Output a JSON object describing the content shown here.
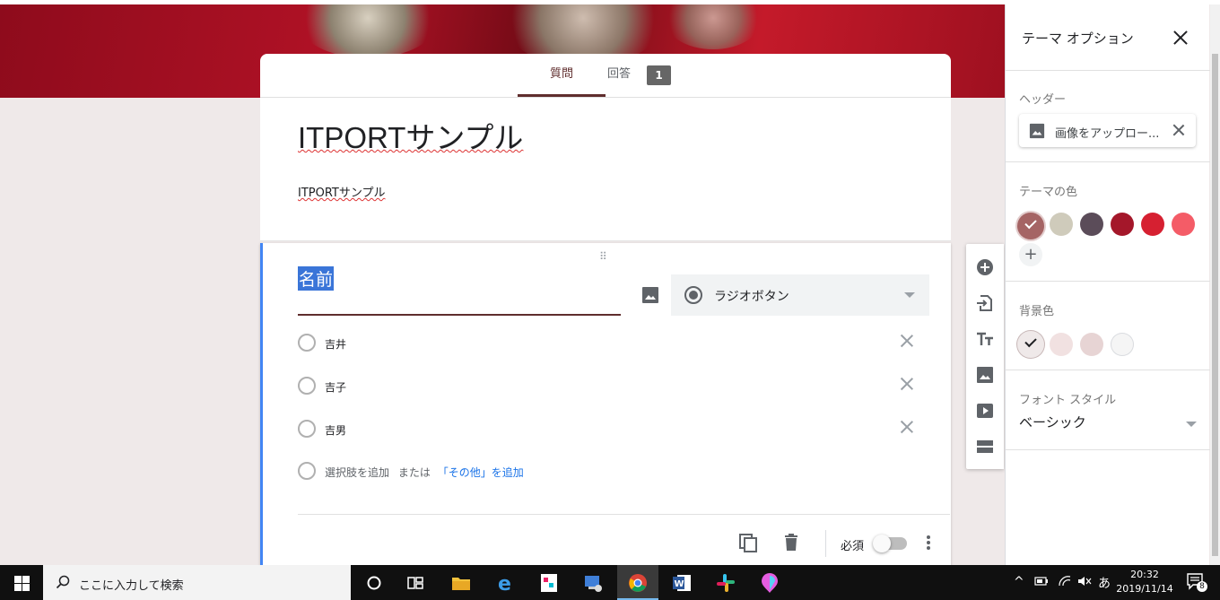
{
  "form": {
    "tabs": [
      {
        "label": "質問",
        "active": true
      },
      {
        "label": "回答",
        "active": false,
        "badge": "1"
      }
    ],
    "title": "ITPORTサンプル",
    "description": "ITPORTサンプル"
  },
  "question": {
    "title": "名前",
    "type_label": "ラジオボタン",
    "options": [
      "吉井",
      "吉子",
      "吉男"
    ],
    "add_option": "選択肢を追加",
    "or_text": "または",
    "add_other": "「その他」を追加",
    "required_label": "必須",
    "required": false
  },
  "panel": {
    "title": "テーマ オプション",
    "header_label": "ヘッダー",
    "upload_label": "画像をアップロー...",
    "theme_color_label": "テーマの色",
    "theme_colors": [
      "#a56464",
      "#cfcbbb",
      "#5b4c59",
      "#a4172a",
      "#d62031",
      "#f45c67"
    ],
    "selected_theme_color": "#a56464",
    "bg_color_label": "背景色",
    "bg_colors": [
      "#efe9e9",
      "#f1e1e1",
      "#e7d4d4",
      "#f5f5f5"
    ],
    "font_style_label": "フォント スタイル",
    "font_style_value": "ベーシック"
  },
  "taskbar": {
    "search_placeholder": "ここに入力して検索",
    "ime_indicator": "あ",
    "time": "20:32",
    "date": "2019/11/14",
    "notification_count": "8"
  }
}
